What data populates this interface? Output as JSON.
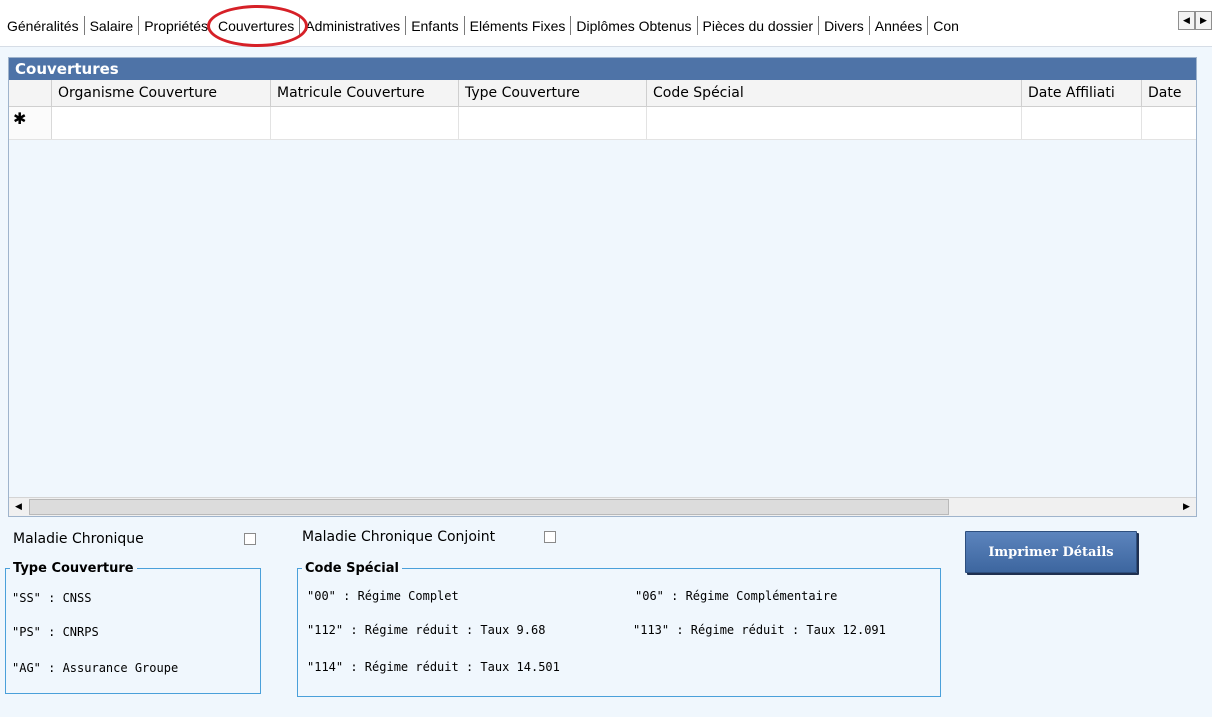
{
  "tabs": [
    "Généralités",
    "Salaire",
    "Propriétés",
    "Couvertures",
    "Administratives",
    "Enfants",
    "Eléments Fixes",
    "Diplômes Obtenus",
    "Pièces du dossier",
    "Divers",
    "Années",
    "Con"
  ],
  "active_tab": "Couvertures",
  "tab_scroll": {
    "left": "◀",
    "right": "▶"
  },
  "grid": {
    "title": "Couvertures",
    "columns": [
      "Organisme Couverture",
      "Matricule Couverture",
      "Type Couverture",
      "Code Spécial",
      "Date Affiliati",
      "Date"
    ],
    "new_row_marker": "✱",
    "scroll_left": "◀",
    "scroll_right": "▶"
  },
  "controls": {
    "maladie_chronique": "Maladie Chronique",
    "maladie_chronique_conjoint": "Maladie Chronique Conjoint",
    "print_button": "Imprimer Détails"
  },
  "type_couverture": {
    "legend": "Type Couverture",
    "items": [
      "\"SS\" : CNSS",
      "\"PS\" : CNRPS",
      "\"AG\" : Assurance Groupe"
    ]
  },
  "code_special": {
    "legend": "Code Spécial",
    "items": [
      "\"00\" : Régime Complet",
      "\"06\" : Régime Complémentaire",
      "\"112\" : Régime réduit : Taux 9.68",
      "\"113\" : Régime réduit : Taux 12.091",
      "\"114\" : Régime réduit : Taux 14.501"
    ]
  }
}
